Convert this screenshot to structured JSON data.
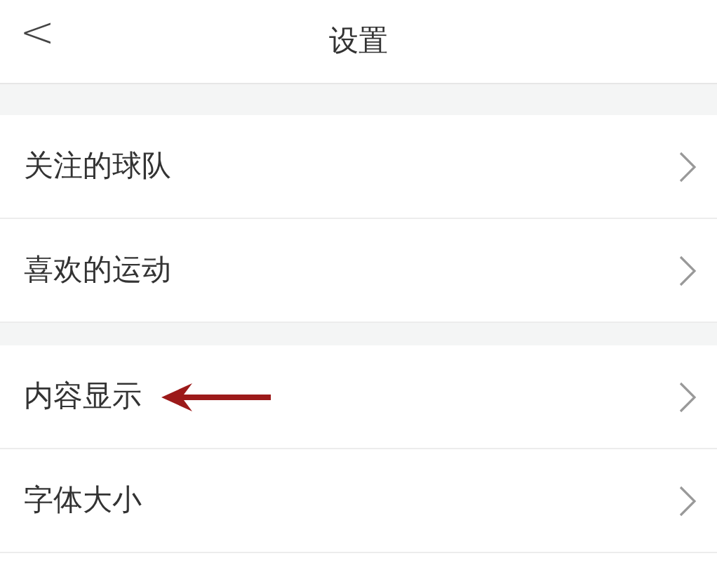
{
  "header": {
    "back": "<",
    "title": "设置"
  },
  "groups": [
    {
      "items": [
        {
          "label": "关注的球队",
          "marked": false
        },
        {
          "label": "喜欢的运动",
          "marked": false
        }
      ]
    },
    {
      "items": [
        {
          "label": "内容显示",
          "marked": true
        },
        {
          "label": "字体大小",
          "marked": false
        }
      ]
    }
  ]
}
